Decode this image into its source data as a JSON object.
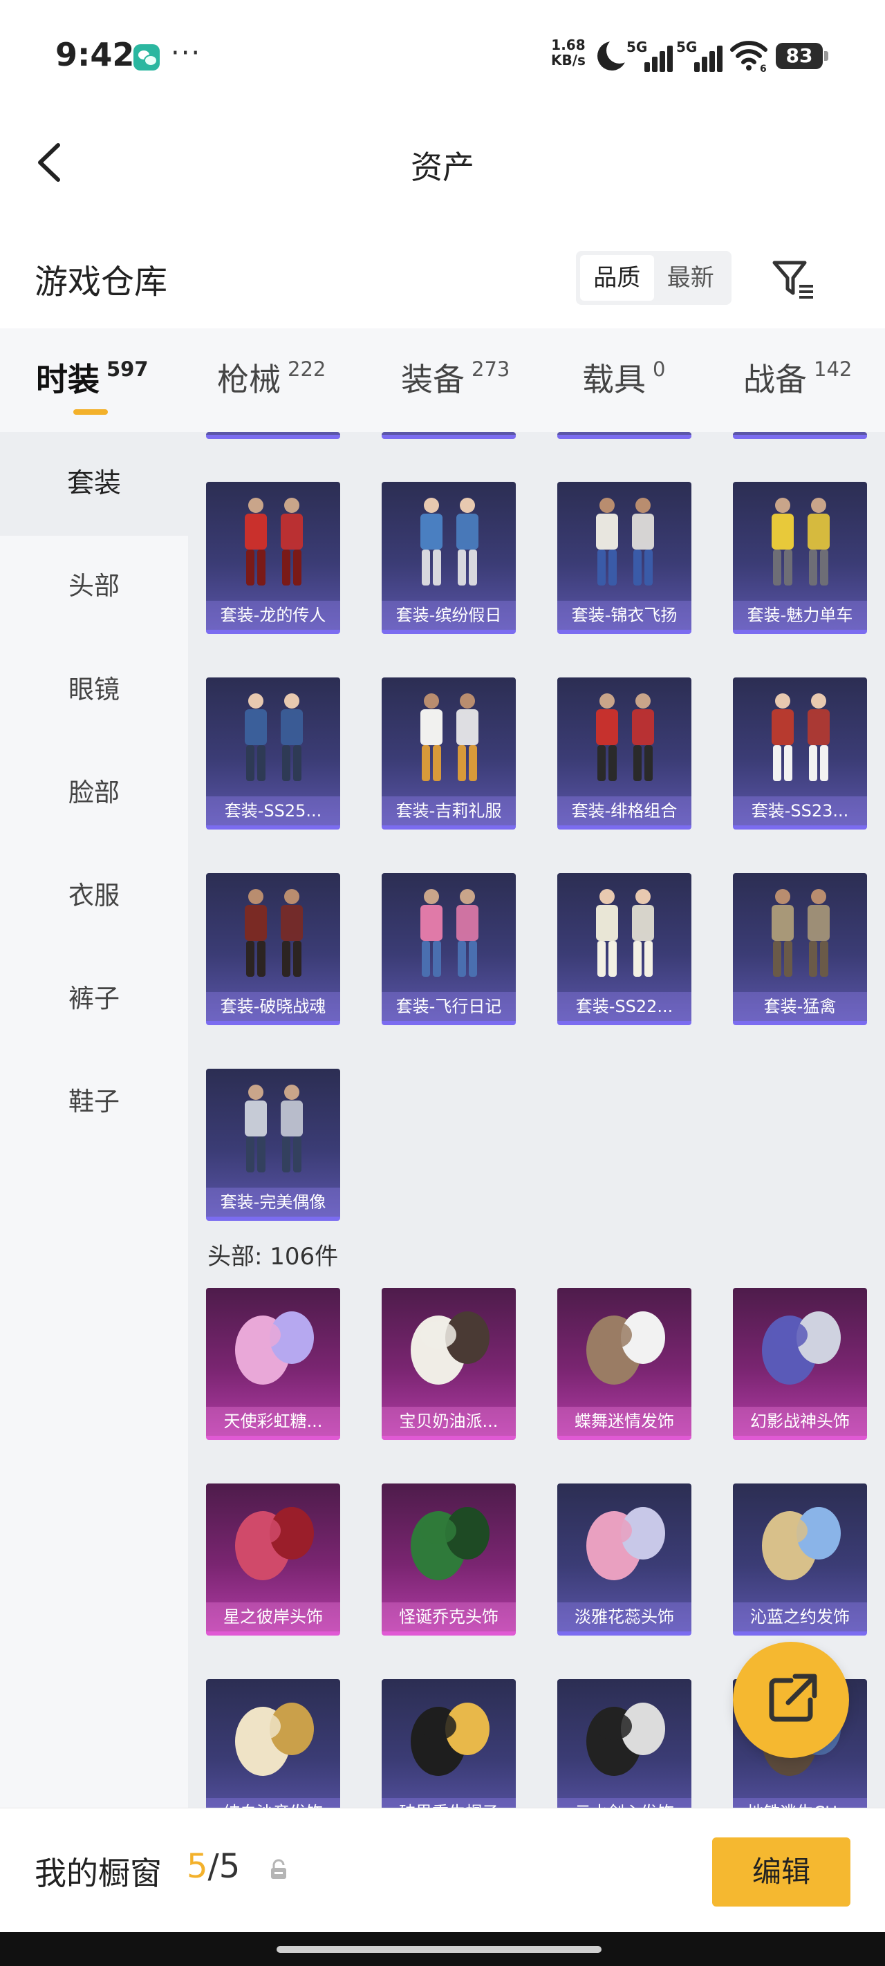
{
  "status_bar": {
    "time": "9:42",
    "more": "···",
    "net_speed_value": "1.68",
    "net_speed_unit": "KB/s",
    "sim1": "5G",
    "sim2": "5G",
    "wifi_sub": "6",
    "battery": "83"
  },
  "header": {
    "title": "资产"
  },
  "warehouse": {
    "title": "游戏仓库",
    "sort_options": [
      "品质",
      "最新"
    ],
    "active_sort": "品质"
  },
  "category_tabs": [
    {
      "name": "时装",
      "count": "597",
      "active": true
    },
    {
      "name": "枪械",
      "count": "222",
      "active": false
    },
    {
      "name": "装备",
      "count": "273",
      "active": false
    },
    {
      "name": "载具",
      "count": "0",
      "active": false
    },
    {
      "name": "战备",
      "count": "142",
      "active": false
    }
  ],
  "sidebar": {
    "items": [
      "套装",
      "头部",
      "眼镜",
      "脸部",
      "衣服",
      "裤子",
      "鞋子"
    ],
    "active": "套装"
  },
  "sections": {
    "suits": {
      "items": [
        {
          "name": "套装-龙的传人",
          "rarity": "blue"
        },
        {
          "name": "套装-缤纷假日",
          "rarity": "blue"
        },
        {
          "name": "套装-锦衣飞扬",
          "rarity": "blue"
        },
        {
          "name": "套装-魅力单车",
          "rarity": "blue"
        },
        {
          "name": "套装-SS25...",
          "rarity": "blue"
        },
        {
          "name": "套装-吉莉礼服",
          "rarity": "blue"
        },
        {
          "name": "套装-绯格组合",
          "rarity": "blue"
        },
        {
          "name": "套装-SS23...",
          "rarity": "blue"
        },
        {
          "name": "套装-破晓战魂",
          "rarity": "blue"
        },
        {
          "name": "套装-飞行日记",
          "rarity": "blue"
        },
        {
          "name": "套装-SS22...",
          "rarity": "blue"
        },
        {
          "name": "套装-猛禽",
          "rarity": "blue"
        },
        {
          "name": "套装-完美偶像",
          "rarity": "blue"
        }
      ]
    },
    "head": {
      "label": "头部: 106件",
      "items": [
        {
          "name": "天使彩虹糖...",
          "rarity": "pink"
        },
        {
          "name": "宝贝奶油派...",
          "rarity": "pink"
        },
        {
          "name": "蝶舞迷情发饰",
          "rarity": "pink"
        },
        {
          "name": "幻影战神头饰",
          "rarity": "pink"
        },
        {
          "name": "星之彼岸头饰",
          "rarity": "pink"
        },
        {
          "name": "怪诞乔克头饰",
          "rarity": "pink"
        },
        {
          "name": "淡雅花蕊头饰",
          "rarity": "blue"
        },
        {
          "name": "沁蓝之约发饰",
          "rarity": "blue"
        },
        {
          "name": "纯白沙音发饰",
          "rarity": "blue"
        },
        {
          "name": "破界重生帽子",
          "rarity": "blue"
        },
        {
          "name": "云水剑心发饰",
          "rarity": "blue"
        },
        {
          "name": "地铁逃生CH...",
          "rarity": "blue"
        }
      ]
    }
  },
  "showcase": {
    "label": "我的橱窗",
    "current": "5",
    "separator": "/",
    "max": "5",
    "edit_label": "编辑"
  },
  "colors": {
    "accent": "#f3b12b",
    "rarity_blue": "#7b6cf0",
    "rarity_pink": "#e05ad4"
  }
}
